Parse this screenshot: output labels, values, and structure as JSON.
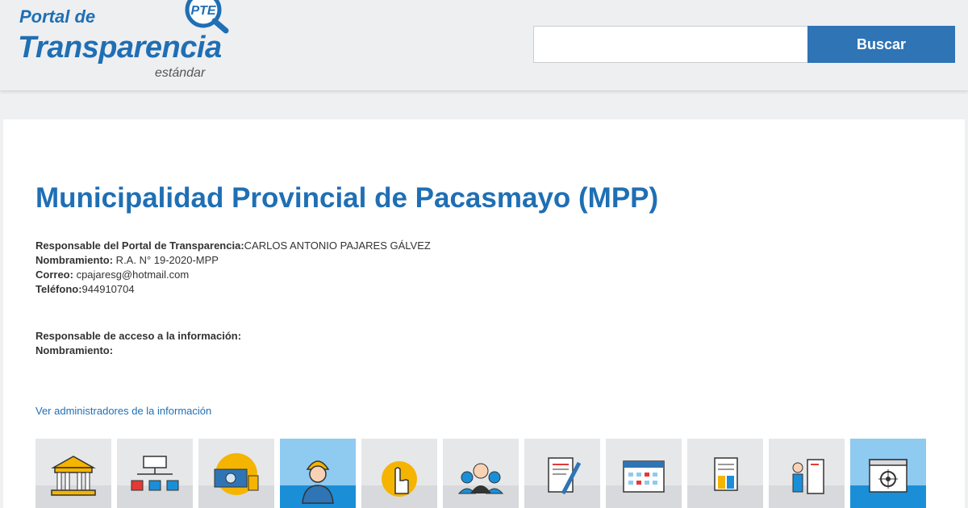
{
  "header": {
    "logo": {
      "line1": "Portal de",
      "line2": "Transparencia",
      "line3": "estándar",
      "badge": "PTE"
    },
    "search": {
      "placeholder": "",
      "button_label": "Buscar"
    }
  },
  "main": {
    "title": "Municipalidad Provincial de Pacasmayo (MPP)",
    "responsable": {
      "label": "Responsable del Portal de Transparencia:",
      "value": "CARLOS ANTONIO PAJARES GÁLVEZ"
    },
    "nombramiento": {
      "label": "Nombramiento:",
      "value": " R.A. N° 19-2020-MPP"
    },
    "correo": {
      "label": "Correo:",
      "value": " cpajaresg@hotmail.com"
    },
    "telefono": {
      "label": "Teléfono:",
      "value": "944910704"
    },
    "acceso": {
      "label": "Responsable de acceso a la información:",
      "nombramiento_label": "Nombramiento:"
    },
    "admin_link": "Ver administradores de la información",
    "tiles": [
      {
        "icon": "government-building-icon",
        "active": false
      },
      {
        "icon": "org-chart-icon",
        "active": false
      },
      {
        "icon": "budget-money-icon",
        "active": false
      },
      {
        "icon": "worker-icon",
        "active": true
      },
      {
        "icon": "hand-pointer-icon",
        "active": false
      },
      {
        "icon": "people-group-icon",
        "active": false
      },
      {
        "icon": "document-sign-icon",
        "active": false
      },
      {
        "icon": "calendar-icon",
        "active": false
      },
      {
        "icon": "documents-icon",
        "active": false
      },
      {
        "icon": "person-exit-icon",
        "active": false
      },
      {
        "icon": "target-window-icon",
        "active": true
      }
    ]
  },
  "colors": {
    "brand": "#1f6fb4",
    "button": "#2f74b5",
    "tile_active_bg": "#8fcaf0",
    "tile_active_band": "#1a8fd8"
  }
}
